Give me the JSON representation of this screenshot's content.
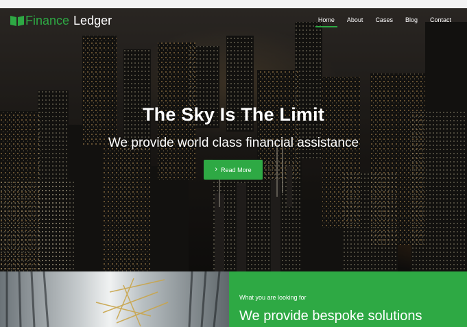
{
  "brand": {
    "name_part1": "Finance",
    "name_part2": "Ledger",
    "icon": "book-icon",
    "accent_color": "#2ea944"
  },
  "nav": {
    "items": [
      {
        "label": "Home",
        "active": true
      },
      {
        "label": "About",
        "active": false
      },
      {
        "label": "Cases",
        "active": false
      },
      {
        "label": "Blog",
        "active": false
      },
      {
        "label": "Contact",
        "active": false
      }
    ]
  },
  "hero": {
    "title": "The Sky Is The Limit",
    "subtitle": "We provide world class financial assistance",
    "cta_label": "Read More",
    "cta_icon": "chevron-right-icon",
    "background": "night city skyline aerial"
  },
  "section": {
    "kicker": "What you are looking for",
    "title": "We provide bespoke solutions"
  }
}
